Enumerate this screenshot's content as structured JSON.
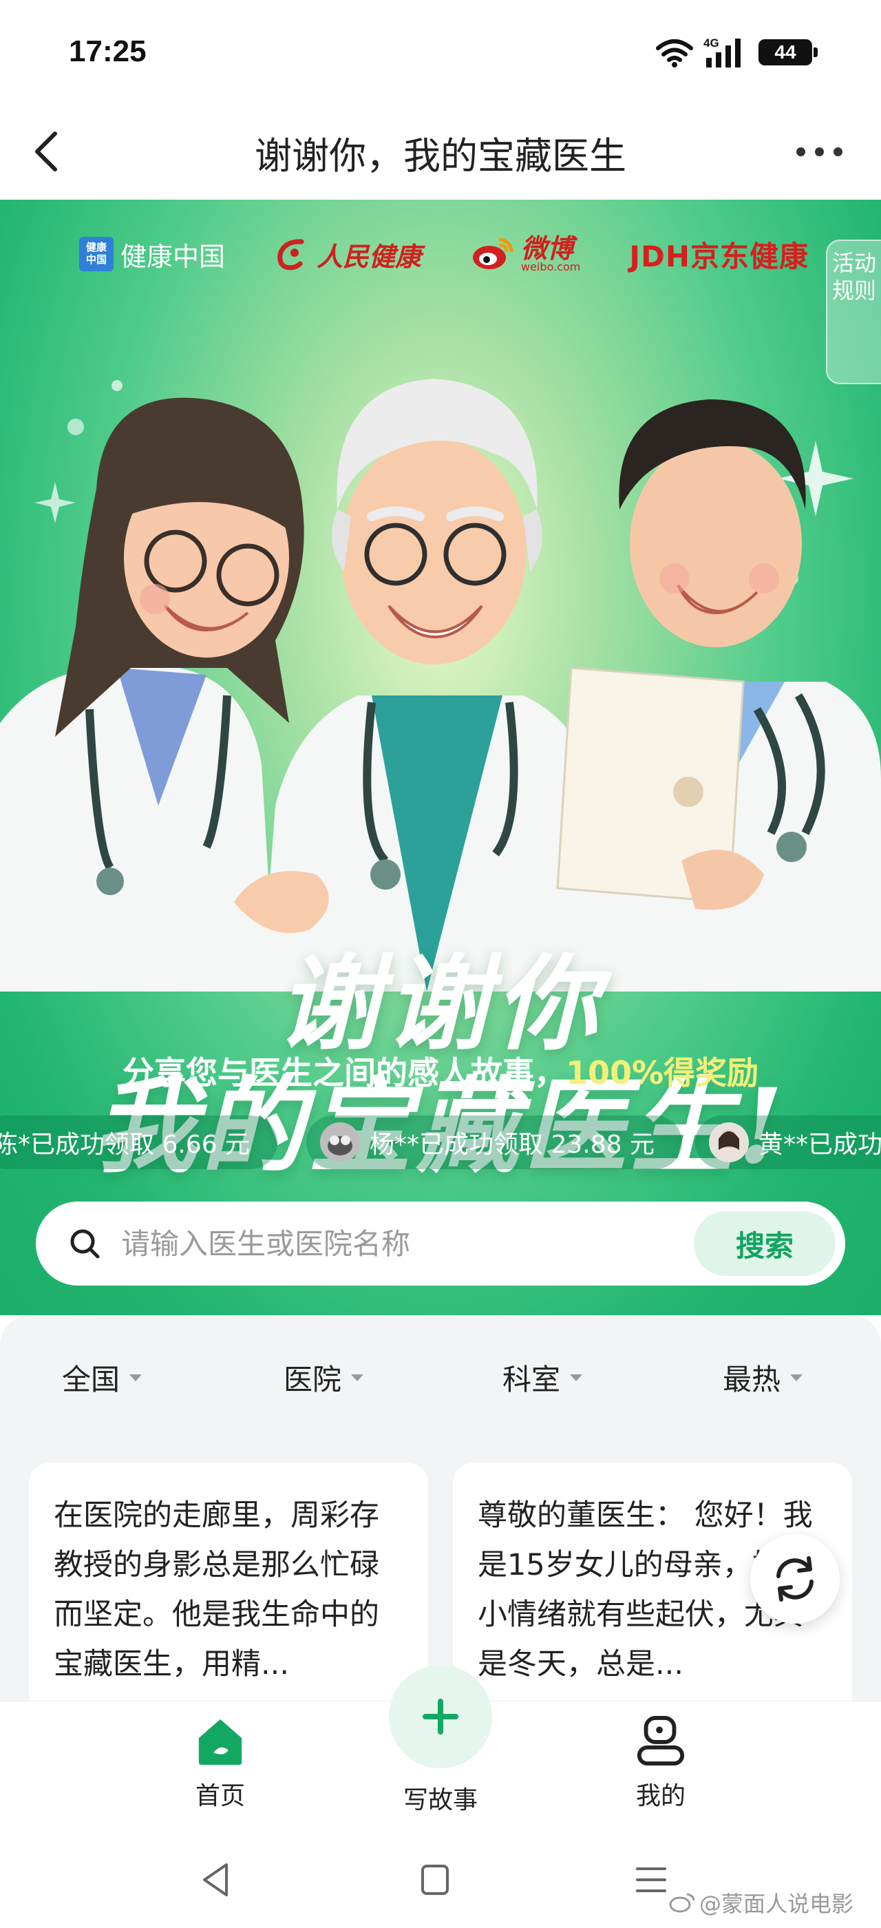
{
  "status_bar": {
    "time": "17:25",
    "network": "4G",
    "battery": "44"
  },
  "nav": {
    "title": "谢谢你，我的宝藏医生"
  },
  "hero": {
    "partners": [
      {
        "name": "健康中国",
        "icon": "jiankang-zhongguo-logo"
      },
      {
        "name": "人民健康",
        "icon": "renmin-jiankang-logo"
      },
      {
        "name": "微博",
        "sub": "weibo.com",
        "icon": "weibo-logo"
      },
      {
        "name": "JDH京东健康",
        "icon": "jd-health-logo"
      }
    ],
    "rules_tab": "活动规则",
    "headline_line1": "谢谢你",
    "headline_line2": "我的宝藏医生!",
    "subtitle_main": "分享您与医生之间的感人故事，",
    "subtitle_highlight": "100%得奖励",
    "ticker": [
      "陈*已成功领取 6.66 元",
      "杨**已成功领取 23.88 元",
      "黄**已成功"
    ]
  },
  "search": {
    "placeholder": "请输入医生或医院名称",
    "button_label": "搜索"
  },
  "filters": [
    {
      "label": "全国"
    },
    {
      "label": "医院"
    },
    {
      "label": "科室"
    },
    {
      "label": "最热"
    }
  ],
  "stories": [
    {
      "text": "在医院的走廊里，周彩存教授的身影总是那么忙碌而坚定。他是我生命中的宝藏医生，用精..."
    },
    {
      "text": "尊敬的董医生： 您好！我是15岁女儿的母亲，她从小情绪就有些起伏，尤其是冬天，总是..."
    }
  ],
  "tab_bar": {
    "home": "首页",
    "write": "写故事",
    "mine": "我的"
  },
  "watermark": "@蒙面人说电影",
  "colors": {
    "brand_green": "#1fb46c",
    "accent_yellow": "#f4f07a",
    "search_button_bg": "#dff5ea"
  }
}
